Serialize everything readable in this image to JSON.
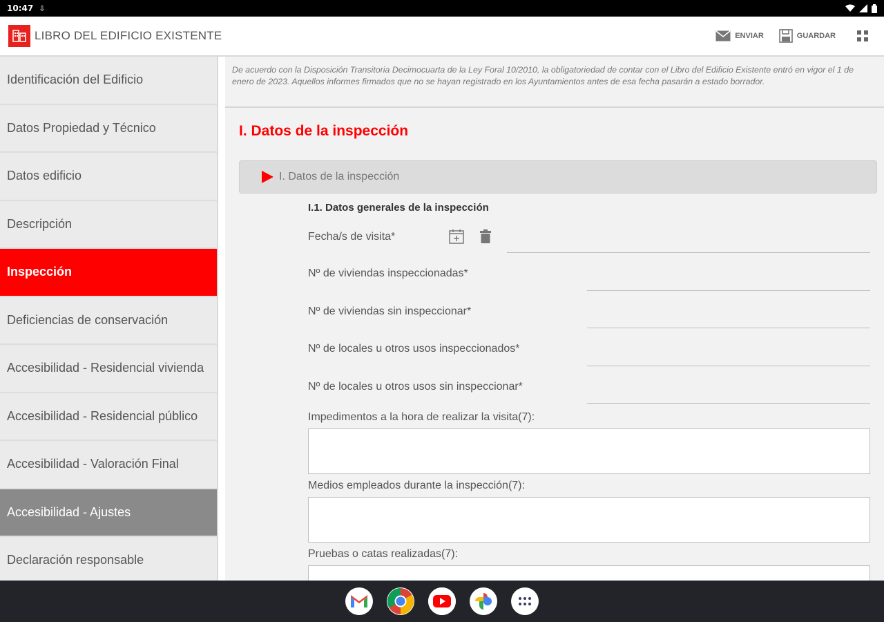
{
  "status": {
    "time": "10:47"
  },
  "app": {
    "title": "LIBRO DEL EDIFICIO EXISTENTE"
  },
  "toolbar": {
    "send_label": "ENVIAR",
    "save_label": "GUARDAR"
  },
  "sidebar": {
    "items": [
      {
        "label": "Identificación del Edificio"
      },
      {
        "label": "Datos Propiedad y Técnico"
      },
      {
        "label": "Datos edificio"
      },
      {
        "label": "Descripción"
      },
      {
        "label": "Inspección"
      },
      {
        "label": "Deficiencias de conservación"
      },
      {
        "label": "Accesibilidad - Residencial vivienda"
      },
      {
        "label": "Accesibilidad - Residencial público"
      },
      {
        "label": "Accesibilidad - Valoración Final"
      },
      {
        "label": "Accesibilidad - Ajustes"
      },
      {
        "label": "Declaración responsable"
      }
    ],
    "active_index": 4,
    "highlighted_index": 9
  },
  "main": {
    "notice": "De acuerdo con la Disposición Transitoria Decimocuarta de la Ley Foral 10/2010, la obligatoriedad de contar con el Libro del Edificio Existente entró en vigor el 1 de enero de 2023. Aquellos informes firmados que no se hayan registrado en los Ayuntamientos antes de esa fecha pasarán a estado borrador.",
    "section_title": "I. Datos de la inspección",
    "accordion_label": "I. Datos de la inspección",
    "subsection": "I.1. Datos generales de la inspección",
    "fields": {
      "visit_dates": {
        "label": "Fecha/s de visita*",
        "value": ""
      },
      "dwellings_inspected": {
        "label": "Nº de viviendas inspeccionadas*",
        "value": ""
      },
      "dwellings_not_inspected": {
        "label": "Nº de viviendas sin inspeccionar*",
        "value": ""
      },
      "premises_inspected": {
        "label": "Nº de locales u otros usos inspeccionados*",
        "value": ""
      },
      "premises_not_inspected": {
        "label": "Nº de locales u otros usos sin inspeccionar*",
        "value": ""
      },
      "impediments": {
        "label": "Impedimentos a la hora de realizar la visita(7):",
        "value": ""
      },
      "means_used": {
        "label": "Medios empleados durante la inspección(7):",
        "value": ""
      },
      "tests": {
        "label": "Pruebas o catas realizadas(7):",
        "value": ""
      }
    }
  },
  "dock": {
    "apps": [
      "gmail-icon",
      "chrome-icon",
      "youtube-icon",
      "photos-icon",
      "app-drawer-icon"
    ]
  },
  "colors": {
    "accent": "#ff0000",
    "sidebar_bg": "#ebebeb",
    "content_bg": "#f2f2f2",
    "highlight_grey": "#8a8a8a"
  }
}
